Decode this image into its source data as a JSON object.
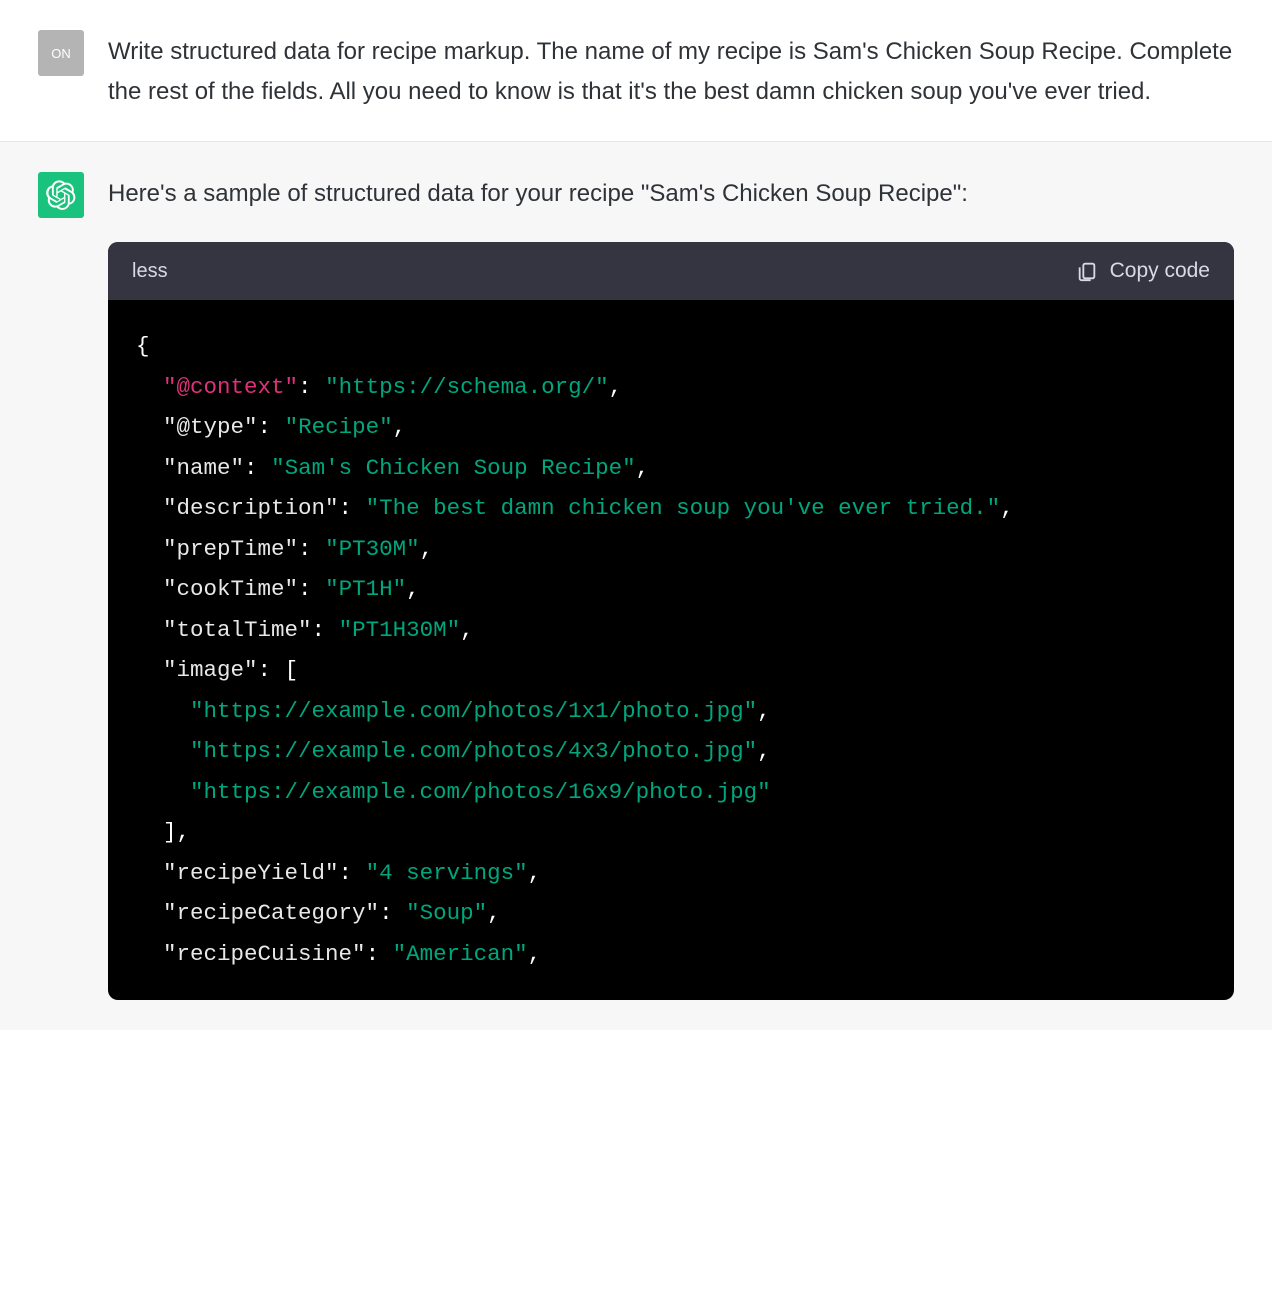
{
  "user": {
    "avatar_label": "ON",
    "message": "Write structured data for recipe markup. The name of my recipe is Sam's Chicken Soup Recipe. Complete the rest of the fields. All you need to know is that it's the best damn chicken soup you've ever tried."
  },
  "assistant": {
    "message": "Here's a sample of structured data for your recipe \"Sam's Chicken Soup Recipe\":"
  },
  "code_block": {
    "language_label": "less",
    "copy_label": "Copy code",
    "json": {
      "context_key": "\"@context\"",
      "context_val": "\"https://schema.org/\"",
      "type_key": "\"@type\"",
      "type_val": "\"Recipe\"",
      "name_key": "\"name\"",
      "name_val": "\"Sam's Chicken Soup Recipe\"",
      "description_key": "\"description\"",
      "description_val": "\"The best damn chicken soup you've ever tried.\"",
      "prepTime_key": "\"prepTime\"",
      "prepTime_val": "\"PT30M\"",
      "cookTime_key": "\"cookTime\"",
      "cookTime_val": "\"PT1H\"",
      "totalTime_key": "\"totalTime\"",
      "totalTime_val": "\"PT1H30M\"",
      "image_key": "\"image\"",
      "image_vals": [
        "\"https://example.com/photos/1x1/photo.jpg\"",
        "\"https://example.com/photos/4x3/photo.jpg\"",
        "\"https://example.com/photos/16x9/photo.jpg\""
      ],
      "recipeYield_key": "\"recipeYield\"",
      "recipeYield_val": "\"4 servings\"",
      "recipeCategory_key": "\"recipeCategory\"",
      "recipeCategory_val": "\"Soup\"",
      "recipeCuisine_key": "\"recipeCuisine\"",
      "recipeCuisine_val": "\"American\""
    }
  }
}
